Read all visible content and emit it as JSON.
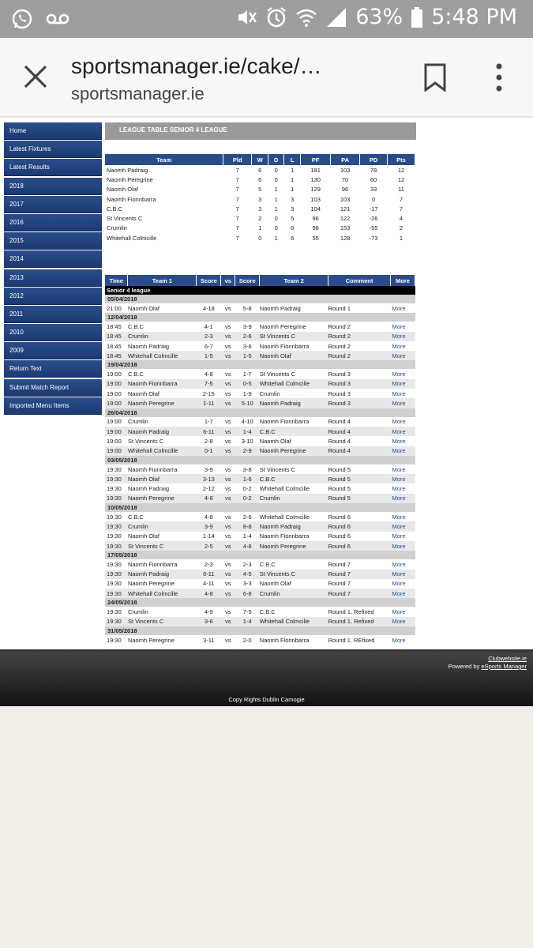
{
  "status_bar": {
    "battery": "63%",
    "time": "5:48 PM"
  },
  "browser": {
    "url": "sportsmanager.ie/cake/…",
    "domain": "sportsmanager.ie"
  },
  "sidebar": {
    "items": [
      "Home",
      "Latest Fixtures",
      "Latest Results",
      "2018",
      "2017",
      "2016",
      "2015",
      "2014",
      "2013",
      "2012",
      "2011",
      "2010",
      "2009",
      "Return Text",
      "Submit Match Report",
      "Imported Menu Items"
    ]
  },
  "league": {
    "title": "LEAGUE TABLE SENIOR 4 LEAGUE",
    "headers": [
      "Team",
      "Pld",
      "W",
      "D",
      "L",
      "PF",
      "PA",
      "PD",
      "Pts"
    ],
    "rows": [
      [
        "Naomh Padraig",
        "7",
        "6",
        "0",
        "1",
        "181",
        "103",
        "78",
        "12"
      ],
      [
        "Naomh Peregrine",
        "7",
        "6",
        "0",
        "1",
        "130",
        "70",
        "60",
        "12"
      ],
      [
        "Naomh Olaf",
        "7",
        "5",
        "1",
        "1",
        "129",
        "96",
        "33",
        "11"
      ],
      [
        "Naomh Fionnbarra",
        "7",
        "3",
        "1",
        "3",
        "103",
        "103",
        "0",
        "7"
      ],
      [
        "C.B.C",
        "7",
        "3",
        "1",
        "3",
        "104",
        "121",
        "-17",
        "7"
      ],
      [
        "St Vincents C",
        "7",
        "2",
        "0",
        "5",
        "96",
        "122",
        "-26",
        "4"
      ],
      [
        "Crumlin",
        "7",
        "1",
        "0",
        "6",
        "98",
        "153",
        "-55",
        "2"
      ],
      [
        "Whitehall Colmcille",
        "7",
        "0",
        "1",
        "6",
        "55",
        "128",
        "-73",
        "1"
      ]
    ]
  },
  "fixtures": {
    "headers": [
      "Time",
      "Team 1",
      "Score",
      "vs",
      "Score",
      "Team 2",
      "Comment",
      "More"
    ],
    "competition": "Senior 4 league",
    "groups": [
      {
        "date": "05/04/2018",
        "rows": [
          [
            "21:00",
            "Naomh Olaf",
            "4-18",
            "vs",
            "5-8",
            "Naomh Padraig",
            "Round 1",
            "More"
          ]
        ]
      },
      {
        "date": "12/04/2018",
        "rows": [
          [
            "18:45",
            "C.B.C",
            "4-1",
            "vs",
            "3-9",
            "Naomh Peregrine",
            "Round 2",
            "More"
          ],
          [
            "18:45",
            "Crumlin",
            "2-3",
            "vs",
            "2-6",
            "St Vincents C",
            "Round 2",
            "More"
          ],
          [
            "18:45",
            "Naomh Padraig",
            "6-7",
            "vs",
            "3-6",
            "Naomh Fionnbarra",
            "Round 2",
            "More"
          ],
          [
            "18:45",
            "Whitehall Colmcille",
            "1-5",
            "vs",
            "1-5",
            "Naomh Olaf",
            "Round 2",
            "More"
          ]
        ]
      },
      {
        "date": "19/04/2018",
        "rows": [
          [
            "19:00",
            "C.B.C",
            "4-8",
            "vs",
            "1-7",
            "St Vincents C",
            "Round 3",
            "More"
          ],
          [
            "19:00",
            "Naomh Fionnbarra",
            "7-5",
            "vs",
            "0-5",
            "Whitehall Colmcille",
            "Round 3",
            "More"
          ],
          [
            "19:00",
            "Naomh Olaf",
            "2-15",
            "vs",
            "1-9",
            "Crumlin",
            "Round 3",
            "More"
          ],
          [
            "19:00",
            "Naomh Peregrine",
            "1-11",
            "vs",
            "5-10",
            "Naomh Padraig",
            "Round 3",
            "More"
          ]
        ]
      },
      {
        "date": "26/04/2018",
        "rows": [
          [
            "19:00",
            "Crumlin",
            "1-7",
            "vs",
            "4-10",
            "Naomh Fionnbarra",
            "Round 4",
            "More"
          ],
          [
            "19:00",
            "Naomh Padraig",
            "6-11",
            "vs",
            "1-4",
            "C.B.C",
            "Round 4",
            "More"
          ],
          [
            "19:00",
            "St Vincents C",
            "2-8",
            "vs",
            "3-10",
            "Naomh Olaf",
            "Round 4",
            "More"
          ],
          [
            "19:00",
            "Whitehall Colmcille",
            "0-1",
            "vs",
            "2-9",
            "Naomh Peregrine",
            "Round 4",
            "More"
          ]
        ]
      },
      {
        "date": "03/05/2018",
        "rows": [
          [
            "19:30",
            "Naomh Fionnbarra",
            "3-9",
            "vs",
            "3-8",
            "St Vincents C",
            "Round 5",
            "More"
          ],
          [
            "19:30",
            "Naomh Olaf",
            "3-13",
            "vs",
            "1-6",
            "C.B.C",
            "Round 5",
            "More"
          ],
          [
            "19:30",
            "Naomh Padraig",
            "2-12",
            "vs",
            "0-2",
            "Whitehall Colmcille",
            "Round 5",
            "More"
          ],
          [
            "19:30",
            "Naomh Peregrine",
            "4-8",
            "vs",
            "0-2",
            "Crumlin",
            "Round 5",
            "More"
          ]
        ]
      },
      {
        "date": "10/05/2018",
        "rows": [
          [
            "19:30",
            "C.B.C",
            "4-8",
            "vs",
            "2-6",
            "Whitehall Colmcille",
            "Round 6",
            "More"
          ],
          [
            "19:30",
            "Crumlin",
            "3-9",
            "vs",
            "8-8",
            "Naomh Padraig",
            "Round 6",
            "More"
          ],
          [
            "19:30",
            "Naomh Olaf",
            "1-14",
            "vs",
            "1-4",
            "Naomh Fionnbarra",
            "Round 6",
            "More"
          ],
          [
            "19:30",
            "St Vincents C",
            "2-5",
            "vs",
            "4-8",
            "Naomh Peregrine",
            "Round 6",
            "More"
          ]
        ]
      },
      {
        "date": "17/05/2018",
        "rows": [
          [
            "19:30",
            "Naomh Fionnbarra",
            "2-3",
            "vs",
            "2-3",
            "C.B.C",
            "Round 7",
            "More"
          ],
          [
            "19:30",
            "Naomh Padraig",
            "6-11",
            "vs",
            "4-5",
            "St Vincents C",
            "Round 7",
            "More"
          ],
          [
            "19:30",
            "Naomh Peregrine",
            "4-11",
            "vs",
            "3-3",
            "Naomh Olaf",
            "Round 7",
            "More"
          ],
          [
            "19:30",
            "Whitehall Colmcille",
            "4-8",
            "vs",
            "6-8",
            "Crumlin",
            "Round 7",
            "More"
          ]
        ]
      },
      {
        "date": "24/05/2018",
        "rows": [
          [
            "19:30",
            "Crumlin",
            "4-9",
            "vs",
            "7-5",
            "C.B.C",
            "Round 1. Refixed",
            "More"
          ],
          [
            "19:30",
            "St Vincents C",
            "3-6",
            "vs",
            "1-4",
            "Whitehall Colmcille",
            "Round 1. Refixed",
            "More"
          ]
        ]
      },
      {
        "date": "31/05/2018",
        "rows": [
          [
            "19:30",
            "Naomh Peregrine",
            "3-11",
            "vs",
            "2-0",
            "Naomh Fionnbarra",
            "Round 1. REfixed",
            "More"
          ]
        ]
      }
    ]
  },
  "footer": {
    "link1": "Clubwebsite.ie",
    "powered_prefix": "Powered by ",
    "link2": "eSports Manager",
    "copyright": "Copy Rights Dublin Camogie"
  }
}
